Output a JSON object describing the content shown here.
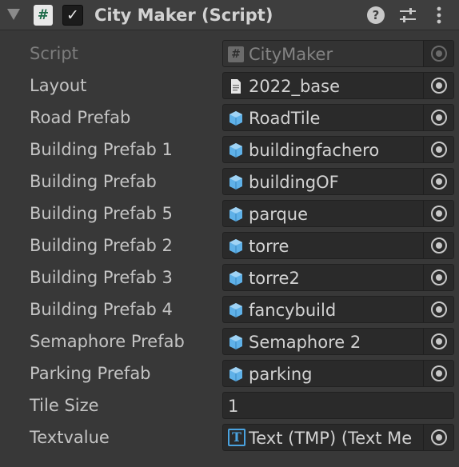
{
  "component": {
    "title": "City Maker (Script)",
    "script_icon": "#",
    "enabled_check": "✓",
    "help_glyph": "?"
  },
  "fields": [
    {
      "label": "Script",
      "value": "CityMaker",
      "icon": "script-icon",
      "disabled": true
    },
    {
      "label": "Layout",
      "value": "2022_base",
      "icon": "text-asset-icon"
    },
    {
      "label": "Road Prefab",
      "value": "RoadTile",
      "icon": "prefab-icon"
    },
    {
      "label": "Building Prefab 1",
      "value": "buildingfachero",
      "icon": "prefab-icon"
    },
    {
      "label": "Building Prefab",
      "value": "buildingOF",
      "icon": "prefab-icon"
    },
    {
      "label": "Building Prefab 5",
      "value": "parque",
      "icon": "prefab-icon"
    },
    {
      "label": "Building Prefab 2",
      "value": "torre",
      "icon": "prefab-icon"
    },
    {
      "label": "Building Prefab 3",
      "value": "torre2",
      "icon": "prefab-icon"
    },
    {
      "label": "Building Prefab 4",
      "value": "fancybuild",
      "icon": "prefab-icon"
    },
    {
      "label": "Semaphore Prefab",
      "value": "Semaphore 2",
      "icon": "prefab-icon"
    },
    {
      "label": "Parking Prefab",
      "value": "parking",
      "icon": "prefab-icon"
    },
    {
      "label": "Tile Size",
      "value": "1",
      "type": "number"
    },
    {
      "label": "Textvalue",
      "value": "Text (TMP) (Text Me",
      "icon": "tmp-text-icon",
      "tmp_glyph": "T"
    }
  ],
  "colors": {
    "background": "#383838",
    "prefab_icon": "#5fb1e8"
  }
}
